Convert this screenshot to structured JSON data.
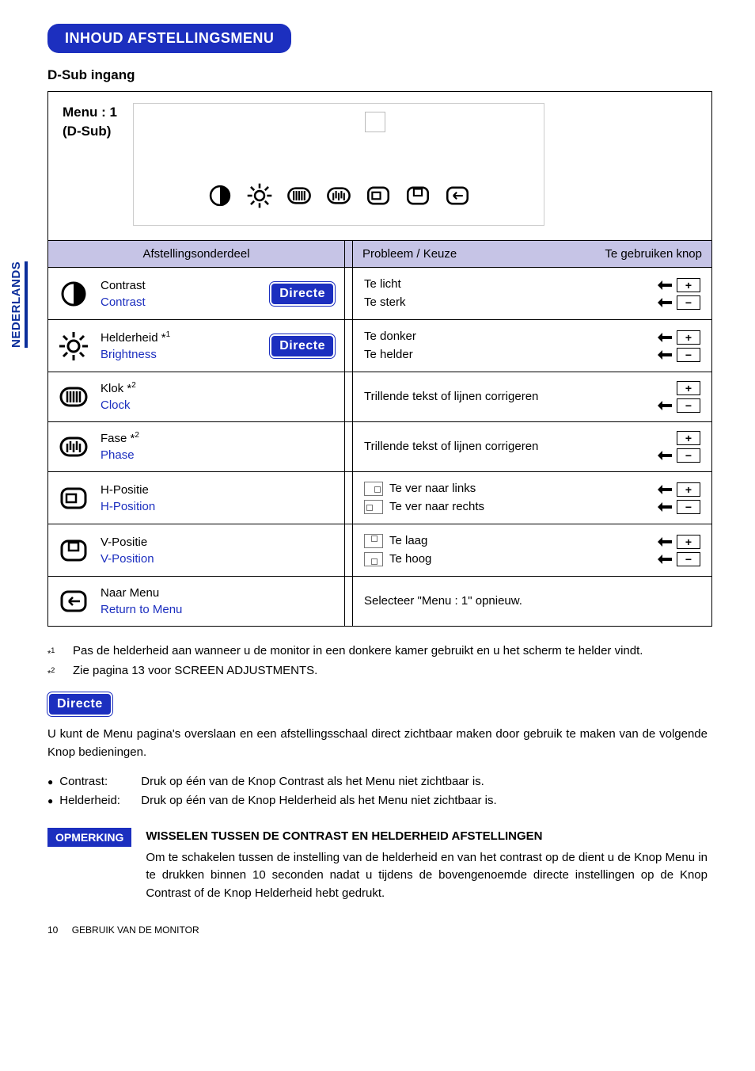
{
  "sideTab": "NEDERLANDS",
  "sectionTitle": "INHOUD AFSTELLINGSMENU",
  "subhead": "D-Sub ingang",
  "menuHeader": {
    "line1": "Menu : 1",
    "line2": "(D-Sub)"
  },
  "tableHeader": {
    "left": "Afstellingsonderdeel",
    "rightA": "Probleem / Keuze",
    "rightB": "Te gebruiken knop"
  },
  "rows": [
    {
      "icon": "contrast",
      "nl": "Contrast",
      "en": "Contrast",
      "badge": "Directe",
      "prob": [
        "Te licht",
        "Te sterk"
      ],
      "knob": "pm-arrows"
    },
    {
      "icon": "brightness",
      "nl": "Helderheid *¹",
      "en": "Brightness",
      "badge": "Directe",
      "prob": [
        "Te donker",
        "Te helder"
      ],
      "knob": "pm-arrows"
    },
    {
      "icon": "clock",
      "nl": "Klok *²",
      "en": "Clock",
      "badge": "",
      "prob": [
        "Trillende tekst of lijnen corrigeren"
      ],
      "knob": "pm-single"
    },
    {
      "icon": "phase",
      "nl": "Fase *²",
      "en": "Phase",
      "badge": "",
      "prob": [
        "Trillende tekst of lijnen corrigeren"
      ],
      "knob": "pm-single"
    },
    {
      "icon": "hpos",
      "nl": "H-Positie",
      "en": "H-Position",
      "badge": "",
      "prob": [
        "Te ver naar links",
        "Te ver naar rechts"
      ],
      "diagram": "h",
      "knob": "pm-arrows"
    },
    {
      "icon": "vpos",
      "nl": "V-Positie",
      "en": "V-Position",
      "badge": "",
      "prob": [
        "Te laag",
        "Te hoog"
      ],
      "diagram": "v",
      "knob": "pm-arrows"
    },
    {
      "icon": "return",
      "nl": "Naar Menu",
      "en": "Return to Menu",
      "badge": "",
      "prob": [
        "Selecteer \"Menu : 1\" opnieuw."
      ],
      "knob": "none"
    }
  ],
  "notes": [
    {
      "marker": "*¹",
      "text": "Pas de helderheid aan wanneer u de monitor in een donkere kamer gebruikt en u het scherm te helder vindt."
    },
    {
      "marker": "*²",
      "text": "Zie pagina 13 voor SCREEN ADJUSTMENTS."
    }
  ],
  "directeBadge": "Directe",
  "directeBody": "U kunt de Menu pagina's overslaan en een afstellingsschaal direct zichtbaar maken door gebruik te maken van de volgende Knop bedieningen.",
  "bullets": [
    {
      "label": "Contrast:",
      "text": "Druk op één van de Knop Contrast als het Menu niet zichtbaar is."
    },
    {
      "label": "Helderheid:",
      "text": "Druk op één van de Knop Helderheid als het Menu niet zichtbaar is."
    }
  ],
  "opmerking": {
    "tag": "OPMERKING",
    "heading": "WISSELEN TUSSEN DE CONTRAST EN HELDERHEID AFSTELLINGEN",
    "body": "Om te schakelen tussen de instelling van de helderheid en van het contrast op de dient u de Knop Menu in te drukken binnen 10 seconden nadat u tijdens de bovengenoemde directe instellingen op de Knop Contrast of de Knop Helderheid hebt gedrukt."
  },
  "footer": {
    "page": "10",
    "text": "GEBRUIK VAN DE MONITOR"
  }
}
